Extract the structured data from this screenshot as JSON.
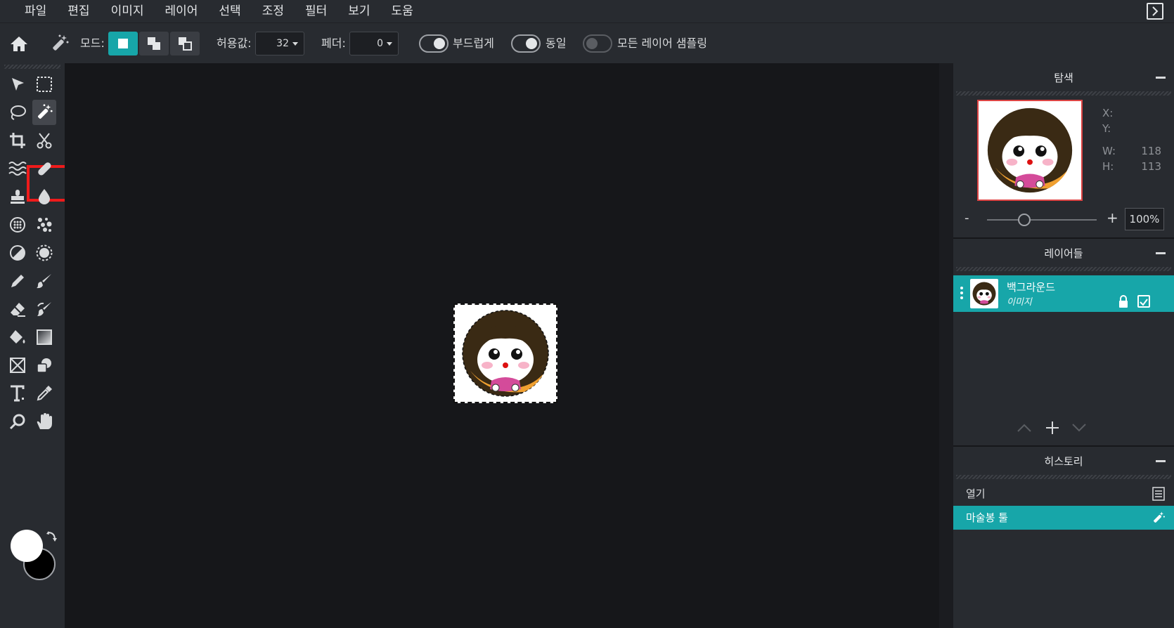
{
  "menu": [
    "파일",
    "편집",
    "이미지",
    "레이어",
    "선택",
    "조정",
    "필터",
    "보기",
    "도움"
  ],
  "options": {
    "mode_label": "모드:",
    "tolerance_label": "허용값:",
    "tolerance_value": "32",
    "feather_label": "페더:",
    "feather_value": "0",
    "antialias_label": "부드럽게",
    "antialias_on": true,
    "contiguous_label": "동일",
    "contiguous_on": true,
    "sample_all_label": "모든 레이어 샘플링",
    "sample_all_on": false
  },
  "navigator": {
    "title": "탐색",
    "x_label": "X:",
    "y_label": "Y:",
    "w_label": "W:",
    "h_label": "H:",
    "w_value": "118",
    "h_value": "113",
    "zoom_minus": "-",
    "zoom_plus": "+",
    "zoom_value": "100%"
  },
  "layers": {
    "title": "레이어들",
    "items": [
      {
        "name": "백그라운드",
        "type": "이미지"
      }
    ]
  },
  "history": {
    "title": "히스토리",
    "items": [
      {
        "label": "열기",
        "icon": "document-icon"
      },
      {
        "label": "마술봉 툴",
        "icon": "magic-wand-icon"
      }
    ]
  },
  "colors": {
    "accent": "#17a6a9",
    "highlight": "#ef1b1b",
    "foreground": "#ffffff",
    "background": "#000000"
  }
}
